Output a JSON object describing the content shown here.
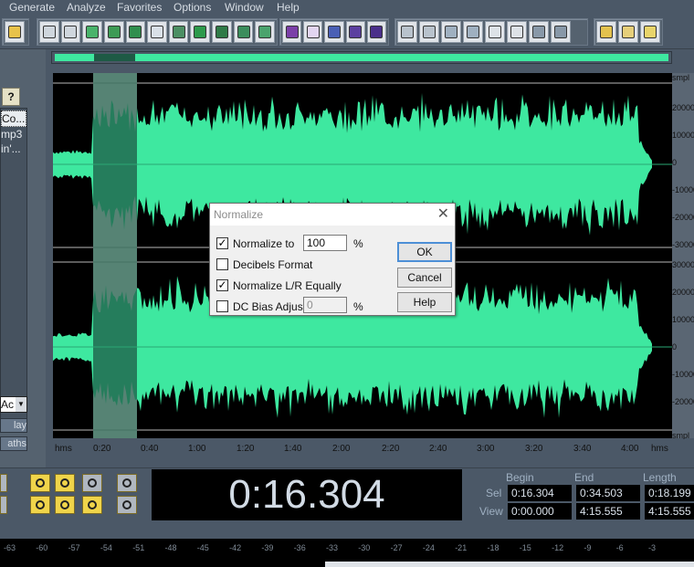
{
  "menu": [
    "Generate",
    "Analyze",
    "Favorites",
    "Options",
    "Window",
    "Help"
  ],
  "toolbar_icons": [
    "new-file-icon",
    "undo-icon",
    "redo-icon",
    "cut-tool-icon",
    "select-icon",
    "copy-icon",
    "scissors-icon",
    "insert-icon",
    "mix-icon",
    "envelope-icon",
    "spectrum-icon",
    "pan-icon",
    "waveform-view-icon",
    "spectral-view-icon",
    "grid-icon",
    "grid2-icon",
    "track-icon",
    "track2-icon",
    "session-icon",
    "play-icon",
    "zoom-icon",
    "time-015-icon",
    "cd-icon",
    "bars-icon",
    "list-icon",
    "settings-icon",
    "script-icon",
    "help-icon"
  ],
  "left_panel": {
    "help_label": "?",
    "files": [
      "Co...",
      "mp3",
      "in'..."
    ],
    "combo_value": "Ac",
    "btn_play": "lay",
    "btn_paths": "aths"
  },
  "right_ruler": {
    "top_unit": "smpl",
    "ch1": [
      "20000",
      "10000",
      "0",
      "-10000",
      "-20000",
      "-30000"
    ],
    "ch2": [
      "30000",
      "20000",
      "10000",
      "0",
      "-10000",
      "-20000"
    ],
    "bottom_unit": "smpl"
  },
  "timeline": [
    "hms",
    "0:20",
    "0:40",
    "1:00",
    "1:20",
    "1:40",
    "2:00",
    "2:20",
    "2:40",
    "3:00",
    "3:20",
    "3:40",
    "4:00",
    "hms"
  ],
  "time_display": "0:16.304",
  "selection": {
    "headers": [
      "Begin",
      "End",
      "Length"
    ],
    "row_sel": "Sel",
    "row_view": "View",
    "sel_begin": "0:16.304",
    "sel_end": "0:34.503",
    "sel_length": "0:18.199",
    "view_begin": "0:00.000",
    "view_end": "4:15.555",
    "view_length": "4:15.555"
  },
  "level_scale": [
    "-63",
    "-60",
    "-57",
    "-54",
    "-51",
    "-48",
    "-45",
    "-42",
    "-39",
    "-36",
    "-33",
    "-30",
    "-27",
    "-24",
    "-21",
    "-18",
    "-15",
    "-12",
    "-9",
    "-6",
    "-3"
  ],
  "dialog": {
    "title": "Normalize",
    "normalize_to_label": "Normalize to",
    "normalize_to_checked": true,
    "normalize_value": "100",
    "percent": "%",
    "decibels_label": "Decibels Format",
    "decibels_checked": false,
    "lr_label": "Normalize L/R Equally",
    "lr_checked": true,
    "dc_label": "DC Bias Adjust",
    "dc_checked": false,
    "dc_value": "0",
    "ok": "OK",
    "cancel": "Cancel",
    "help": "Help"
  },
  "colors": {
    "wave": "#3ee8a0",
    "selection_bg": "#ffffff",
    "selected_wave": "#1e5a45"
  }
}
